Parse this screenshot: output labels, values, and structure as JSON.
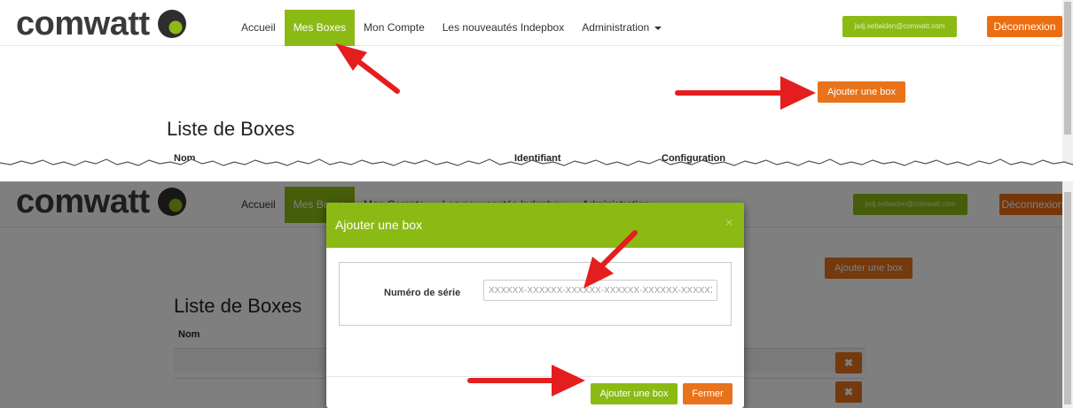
{
  "brand": {
    "logo_text": "comwatt"
  },
  "nav": {
    "items": [
      {
        "label": "Accueil"
      },
      {
        "label": "Mes Boxes"
      },
      {
        "label": "Mon Compte"
      },
      {
        "label": "Les nouveautés Indepbox"
      },
      {
        "label": "Administration"
      }
    ],
    "active_index": 1
  },
  "user": {
    "email": "jsdj.sebaiden@comwatt.com",
    "logout_label": "Déconnexion"
  },
  "page": {
    "add_box_label": "Ajouter une box",
    "title": "Liste de Boxes",
    "columns": [
      "Nom",
      "Identifiant",
      "Configuration"
    ]
  },
  "table": {
    "delete_glyph": "✖"
  },
  "modal": {
    "title": "Ajouter une box",
    "close_glyph": "×",
    "serial_label": "Numéro de série",
    "serial_placeholder": "XXXXXX-XXXXXX-XXXXXX-XXXXXX-XXXXXX-XXXXXX",
    "submit_label": "Ajouter une box",
    "close_label": "Fermer"
  },
  "colors": {
    "brand_green": "#8cba15",
    "brand_orange": "#ec6c11",
    "annotation_red": "#e41e1e"
  },
  "icons": [
    "comwatt-logo-icon",
    "caret-down-icon",
    "close-icon",
    "delete-icon",
    "annotation-arrow"
  ]
}
